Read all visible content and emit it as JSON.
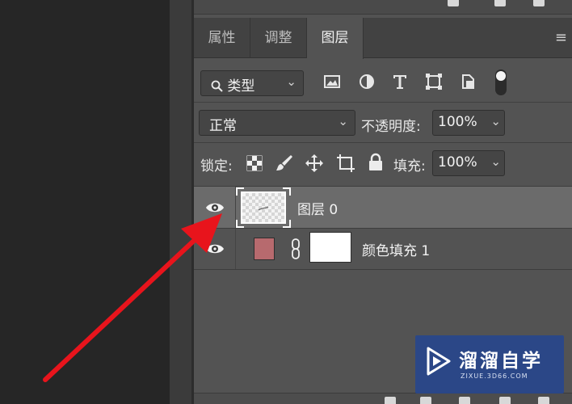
{
  "tabs": [
    {
      "label": "属性",
      "active": false
    },
    {
      "label": "调整",
      "active": false
    },
    {
      "label": "图层",
      "active": true
    }
  ],
  "panel_menu_icon": "hamburger-icon",
  "filter": {
    "kind_label": "类型",
    "icons": [
      "image-filter-icon",
      "adjustment-filter-icon",
      "text-filter-icon",
      "shape-filter-icon",
      "smart-object-filter-icon",
      "filter-toggle-icon"
    ]
  },
  "blend": {
    "mode": "正常",
    "opacity_label": "不透明度:",
    "opacity_value": "100%"
  },
  "lock": {
    "label": "锁定:",
    "icons": [
      "lock-transparent-pixels-icon",
      "lock-image-pixels-icon",
      "lock-position-icon",
      "lock-artboard-icon",
      "lock-all-icon"
    ],
    "fill_label": "填充:",
    "fill_value": "100%"
  },
  "layers": [
    {
      "name": "图层 0",
      "visible": true,
      "selected": true,
      "thumb": "transparent-checker"
    },
    {
      "name": "颜色填充 1",
      "visible": true,
      "selected": false,
      "fill_color": "#b76a6e",
      "mask": "white"
    }
  ],
  "colors": {
    "panel_bg": "#535353",
    "selected_row": "#6b6b6b",
    "annotation_arrow": "#e8141c",
    "watermark_bg": "#28468c"
  },
  "watermark": {
    "title": "溜溜自学",
    "subtitle": "ZIXUE.3D66.COM"
  }
}
